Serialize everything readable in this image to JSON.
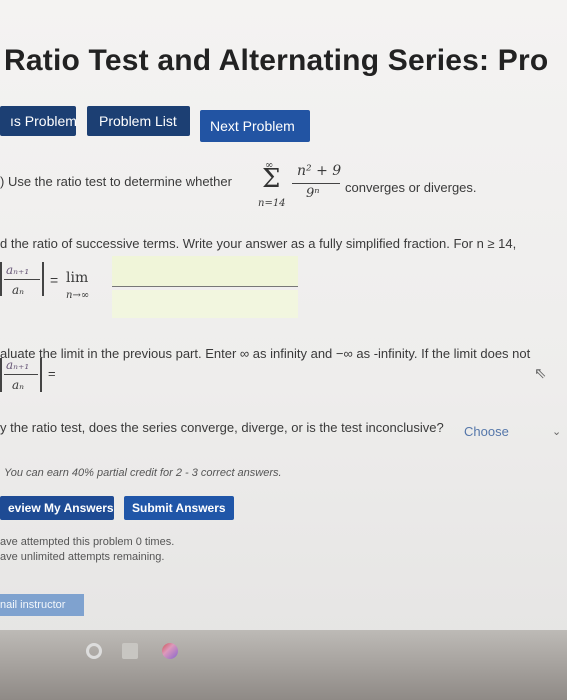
{
  "title": "Ratio Test and Alternating Series: Pro",
  "nav": {
    "prev": "ıs Problem",
    "list": "Problem List",
    "next": "Next Problem"
  },
  "question": {
    "prefix": ") Use the ratio test to determine whether",
    "suffix": "converges or diverges.",
    "sum_upper": "∞",
    "sum_lower": "n=14",
    "numerator": "n² + 9",
    "denominator": "9ⁿ"
  },
  "part_a": {
    "text": "d the ratio of successive terms. Write your answer as a fully simplified fraction. For n ≥ 14,",
    "ratio_num": "aₙ₊₁",
    "ratio_den": "aₙ",
    "lim_word": "lim",
    "lim_sub": "n→∞"
  },
  "part_b": {
    "text": "aluate the limit in the previous part. Enter ∞ as infinity and −∞ as -infinity. If the limit does not",
    "ratio_num": "aₙ₊₁",
    "ratio_den": "aₙ",
    "equals": "="
  },
  "part_c": {
    "text": "y the ratio test, does the series converge, diverge, or is the test inconclusive?",
    "select_value": "Choose"
  },
  "credit_note": "You can earn 40% partial credit for 2 - 3 correct answers.",
  "actions": {
    "preview": "eview My Answers",
    "submit": "Submit Answers"
  },
  "attempts": {
    "line1": "ave attempted this problem 0 times.",
    "line2": "ave unlimited attempts remaining."
  },
  "email": "nail instructor"
}
